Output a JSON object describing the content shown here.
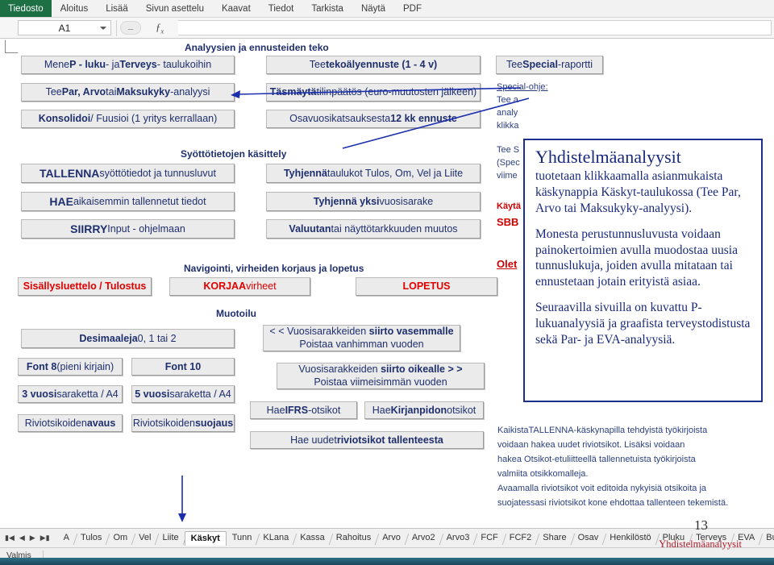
{
  "ribbon": {
    "tabs": [
      {
        "label": "Tiedosto",
        "active": true
      },
      {
        "label": "Aloitus",
        "active": false
      },
      {
        "label": "Lisää",
        "active": false
      },
      {
        "label": "Sivun asettelu",
        "active": false
      },
      {
        "label": "Kaavat",
        "active": false
      },
      {
        "label": "Tiedot",
        "active": false
      },
      {
        "label": "Tarkista",
        "active": false
      },
      {
        "label": "Näytä",
        "active": false
      },
      {
        "label": "PDF",
        "active": false
      }
    ]
  },
  "formula_bar": {
    "name_box_value": "A1",
    "name_box_caret_icon": "chevron-down-icon",
    "cancel_icon": "cancel-icon",
    "insert_function_icon": "fx-icon",
    "formula_value": ""
  },
  "sections": {
    "analyses": "Analyysien ja ennusteiden teko",
    "input_handling": "Syöttötietojen käsittely",
    "navigation": "Navigointi, virheiden korjaus ja lopetus",
    "formatting": "Muotoilu"
  },
  "buttons": {
    "goto_pluku_terveys": {
      "pre": "Mene ",
      "b1": "P - luku",
      "mid": "- ja ",
      "b2": "Terveys",
      "post": "- taulukoihin"
    },
    "par_arvo_maksukyky": {
      "pre": "Tee ",
      "b1": "Par, Arvo",
      "mid": " tai ",
      "b2": "Maksukyky",
      "post": "-analyysi"
    },
    "konsolidoi": {
      "b1": "Konsolidoi",
      "post": " / Fuusioi (1 yritys kerrallaan)"
    },
    "tekoaly": {
      "pre": "Tee ",
      "b1": "tekoälyennuste (1 - 4 v)"
    },
    "tasmayta": {
      "b1": "Täsmäytä",
      "post": " tilinpäätös (euro-muutosten jälkeen)"
    },
    "osavuosi": {
      "pre": "Osavuosikatsauksesta ",
      "b1": "12 kk ennuste"
    },
    "special_raportti": {
      "pre": "Tee ",
      "b1": "Special",
      "post": "-raportti"
    },
    "tallenna": {
      "b1": "TALLENNA",
      "post": " syöttötiedot ja tunnusluvut"
    },
    "hae": {
      "b1": "HAE",
      "post": " aikaisemmin tallennetut tiedot"
    },
    "siirry": {
      "b1": "SIIRRY",
      "post": " Input - ohjelmaan"
    },
    "tyhjenna_taulukot": {
      "b1": "Tyhjennä",
      "post": " taulukot Tulos, Om, Vel ja Liite"
    },
    "tyhjenna_yksi": {
      "b1": "Tyhjennä yksi",
      "post": " vuosisarake"
    },
    "valuutan_muutos": {
      "b1": "Valuutan",
      "post": " tai näyttötarkkuuden muutos"
    },
    "sisallysluettelo": {
      "label": "Sisällysluettelo / Tulostus"
    },
    "korjaa": {
      "b1": "KORJAA",
      "post": " virheet"
    },
    "lopetus": {
      "label": "LOPETUS"
    },
    "desimaaleja": {
      "b1": "Desimaaleja",
      "post": " 0, 1 tai 2"
    },
    "font8": {
      "b1": "Font  8",
      "post": " (pieni kirjain)"
    },
    "font10": {
      "b1": "Font  10"
    },
    "vuosi3": {
      "b1": "3 vuosi",
      "post": "saraketta  / A4"
    },
    "vuosi5": {
      "b1": "5 vuosi",
      "post": "saraketta  / A4"
    },
    "riviotsikot_avaus": {
      "pre": "Riviotsikoiden ",
      "b1": "avaus"
    },
    "riviotsikot_suojaus": {
      "pre": "Riviotsikoiden ",
      "b1": "suojaus"
    },
    "siirto_vasemmalle": {
      "line1_pre": "< < Vuosisarakkeiden ",
      "line1_b": "siirto vasemmalle",
      "line2": "Poistaa vanhimman  vuoden"
    },
    "siirto_oikealle": {
      "line1_pre": "Vuosisarakkeiden ",
      "line1_b": "siirto oikealle",
      "line1_post": "  > >",
      "line2": "Poistaa viimeisimmän  vuoden"
    },
    "hae_ifrs": {
      "pre": "Hae ",
      "b1": "IFRS",
      "post": "-otsikot"
    },
    "hae_kirjanpidon": {
      "pre": "Hae ",
      "b1": "Kirjanpidon",
      "post": " otsikot"
    },
    "hae_uudet_riviotsikot": {
      "pre": "Hae uudet ",
      "b1": "riviotsikot tallenteesta"
    }
  },
  "side_notes": {
    "special_ohje_heading": "Special-ohje:",
    "special_lines": [
      "Tee a",
      "analy",
      "klikka"
    ],
    "special_lines2": [
      "Tee S",
      "(Spec",
      "viime"
    ],
    "kayta": "Käytä",
    "sbb": "SBB",
    "olet": "Olet"
  },
  "bottom_note": {
    "lines": [
      "KaikistaTALLENNA-käskynapilla tehdyistä työkirjoista",
      "voidaan hakea uudet riviotsikot. Lisäksi voidaan",
      "hakea Otsikot-etuliitteellä tallennetuista työkirjoista",
      "valmiita otsikkomalleja.",
      "Avaamalla riviotsikot voit editoida nykyisiä otsikoita ja",
      "suojatessasi riviotsikot kone ehdottaa tallenteen tekemistä."
    ]
  },
  "callout": {
    "title": "Yhdistelmäanalyysit",
    "paragraphs": [
      "tuotetaan klikkaamalla asianmukaista käskynappia Käskyt-taulukossa (Tee Par, Arvo tai Maksukyky-analyysi).",
      "Monesta perustunnusluvusta voidaan painokertoimien avulla muodostaa uusia tunnuslukuja, joiden avulla mitataan tai ennustetaan jotain erityistä asiaa.",
      "Seuraavilla sivuilla on kuvattu P-lukuanalyysiä ja graafista terveystodistusta sekä Par- ja EVA-analyysiä."
    ]
  },
  "page": {
    "number": "13",
    "footer_label": "Yhdistelmäanalyysit"
  },
  "tab_bar": {
    "nav_first_icon": "first-sheet-icon",
    "nav_prev_icon": "prev-sheet-icon",
    "nav_next_icon": "next-sheet-icon",
    "nav_last_icon": "last-sheet-icon",
    "tabs": [
      {
        "label": "A",
        "active": false
      },
      {
        "label": "Tulos",
        "active": false
      },
      {
        "label": "Om",
        "active": false
      },
      {
        "label": "Vel",
        "active": false
      },
      {
        "label": "Liite",
        "active": false
      },
      {
        "label": "Käskyt",
        "active": true
      },
      {
        "label": "Tunn",
        "active": false
      },
      {
        "label": "KLana",
        "active": false
      },
      {
        "label": "Kassa",
        "active": false
      },
      {
        "label": "Rahoitus",
        "active": false
      },
      {
        "label": "Arvo",
        "active": false
      },
      {
        "label": "Arvo2",
        "active": false
      },
      {
        "label": "Arvo3",
        "active": false
      },
      {
        "label": "FCF",
        "active": false
      },
      {
        "label": "FCF2",
        "active": false
      },
      {
        "label": "Share",
        "active": false
      },
      {
        "label": "Osav",
        "active": false
      },
      {
        "label": "Henkilöstö",
        "active": false
      },
      {
        "label": "Pluku",
        "active": false
      },
      {
        "label": "Terveys",
        "active": false
      },
      {
        "label": "EVA",
        "active": false
      },
      {
        "label": "Budjetointi",
        "active": false
      }
    ]
  },
  "status_bar": {
    "text": "Valmis"
  },
  "colors": {
    "accent_blue": "#1f2f6e",
    "red": "#e00000",
    "file_tab_green": "#1d7044",
    "arrow_blue": "#1b2fae"
  }
}
